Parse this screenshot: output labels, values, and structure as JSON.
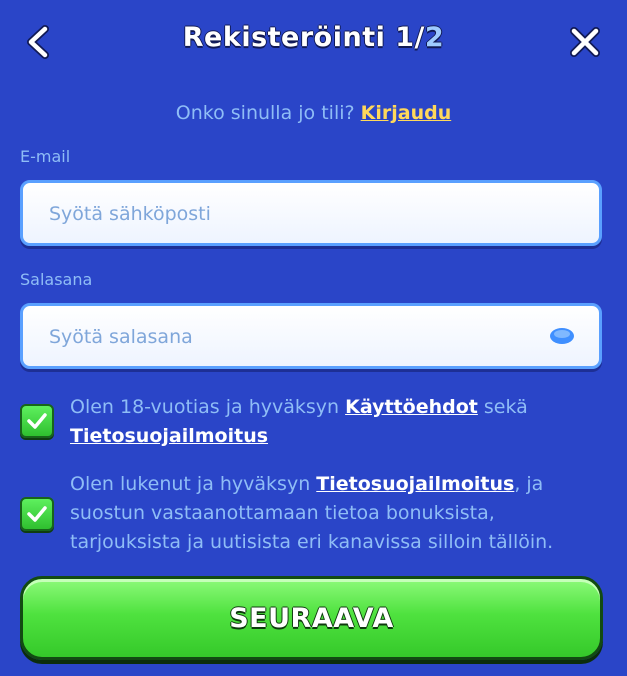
{
  "header": {
    "title_prefix": "Rekisteröinti 1/",
    "title_suffix": "2",
    "back_icon": "chevron-left-icon",
    "close_icon": "close-icon"
  },
  "login_prompt": {
    "text": "Onko sinulla jo tili? ",
    "link_label": "Kirjaudu"
  },
  "email": {
    "label": "E-mail",
    "placeholder": "Syötä sähköposti",
    "value": ""
  },
  "password": {
    "label": "Salasana",
    "placeholder": "Syötä salasana",
    "value": "",
    "toggle_icon": "eye-icon"
  },
  "consents": [
    {
      "checked": true,
      "text_before": "Olen 18-vuotias ja hyväksyn ",
      "link1": "Käyttöehdot",
      "text_middle": " sekä ",
      "link2": "Tietosuojailmoitus"
    },
    {
      "checked": true,
      "text_before": "Olen lukenut ja hyväksyn ",
      "link1": "Tietosuojailmoitus",
      "text_after": ", ja suostun vastaanottamaan tietoa bonuksista, tarjouksista ja uutisista eri kanavissa silloin tällöin."
    }
  ],
  "next_button": {
    "label": "SEURAAVA"
  },
  "colors": {
    "background": "#2a45c8",
    "text_muted": "#8fbdf6",
    "link_yellow": "#ffd85a",
    "button_green": "#4fe23f"
  }
}
